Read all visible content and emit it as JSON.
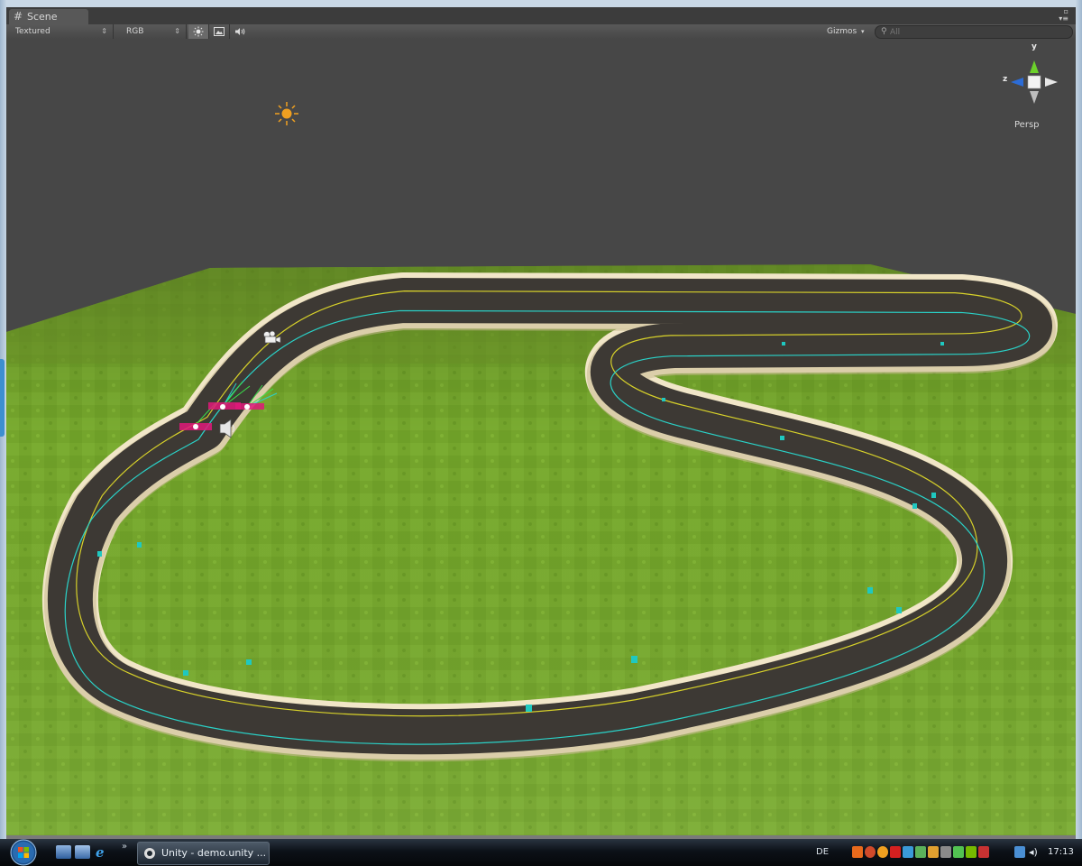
{
  "window": {
    "tab_label": "Scene",
    "tab_icon": "scene-grid-icon"
  },
  "toolbar": {
    "render_mode": "Textured",
    "channel_mode": "RGB",
    "lighting_icon": "sun-lighting-icon",
    "overlay_icon": "image-overlay-icon",
    "audio_icon": "speaker-audio-icon",
    "gizmos_label": "Gizmos",
    "search_placeholder": "All"
  },
  "scene": {
    "projection_label": "Persp",
    "axis_labels": {
      "y": "y",
      "z": "z"
    },
    "sky_color": "#474747",
    "ground_color": "#6f9e2a",
    "track_color": "#3e3a34",
    "track_border_color": "#e8dcc0",
    "racing_line_color": "#d8d22a",
    "waypoint_path_color": "#2ad2c8"
  },
  "taskbar": {
    "task_button_label": "Unity - demo.unity ...",
    "language": "DE",
    "clock": "17:13"
  }
}
